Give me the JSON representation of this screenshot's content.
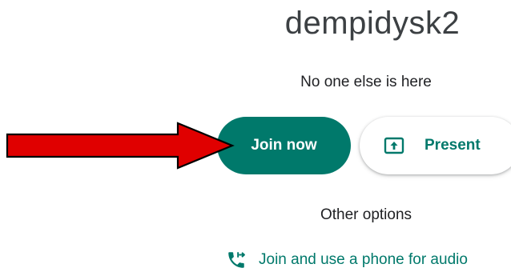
{
  "meeting": {
    "title": "dempidysk2",
    "status": "No one else is here"
  },
  "actions": {
    "join_label": "Join now",
    "present_label": "Present",
    "other_options_label": "Other options",
    "phone_audio_label": "Join and use a phone for audio"
  },
  "icons": {
    "present": "present-screen-icon",
    "phone": "phone-forward-icon",
    "annotation": "red-arrow"
  },
  "colors": {
    "accent": "#00796b",
    "annotation_arrow": "#e00000"
  }
}
